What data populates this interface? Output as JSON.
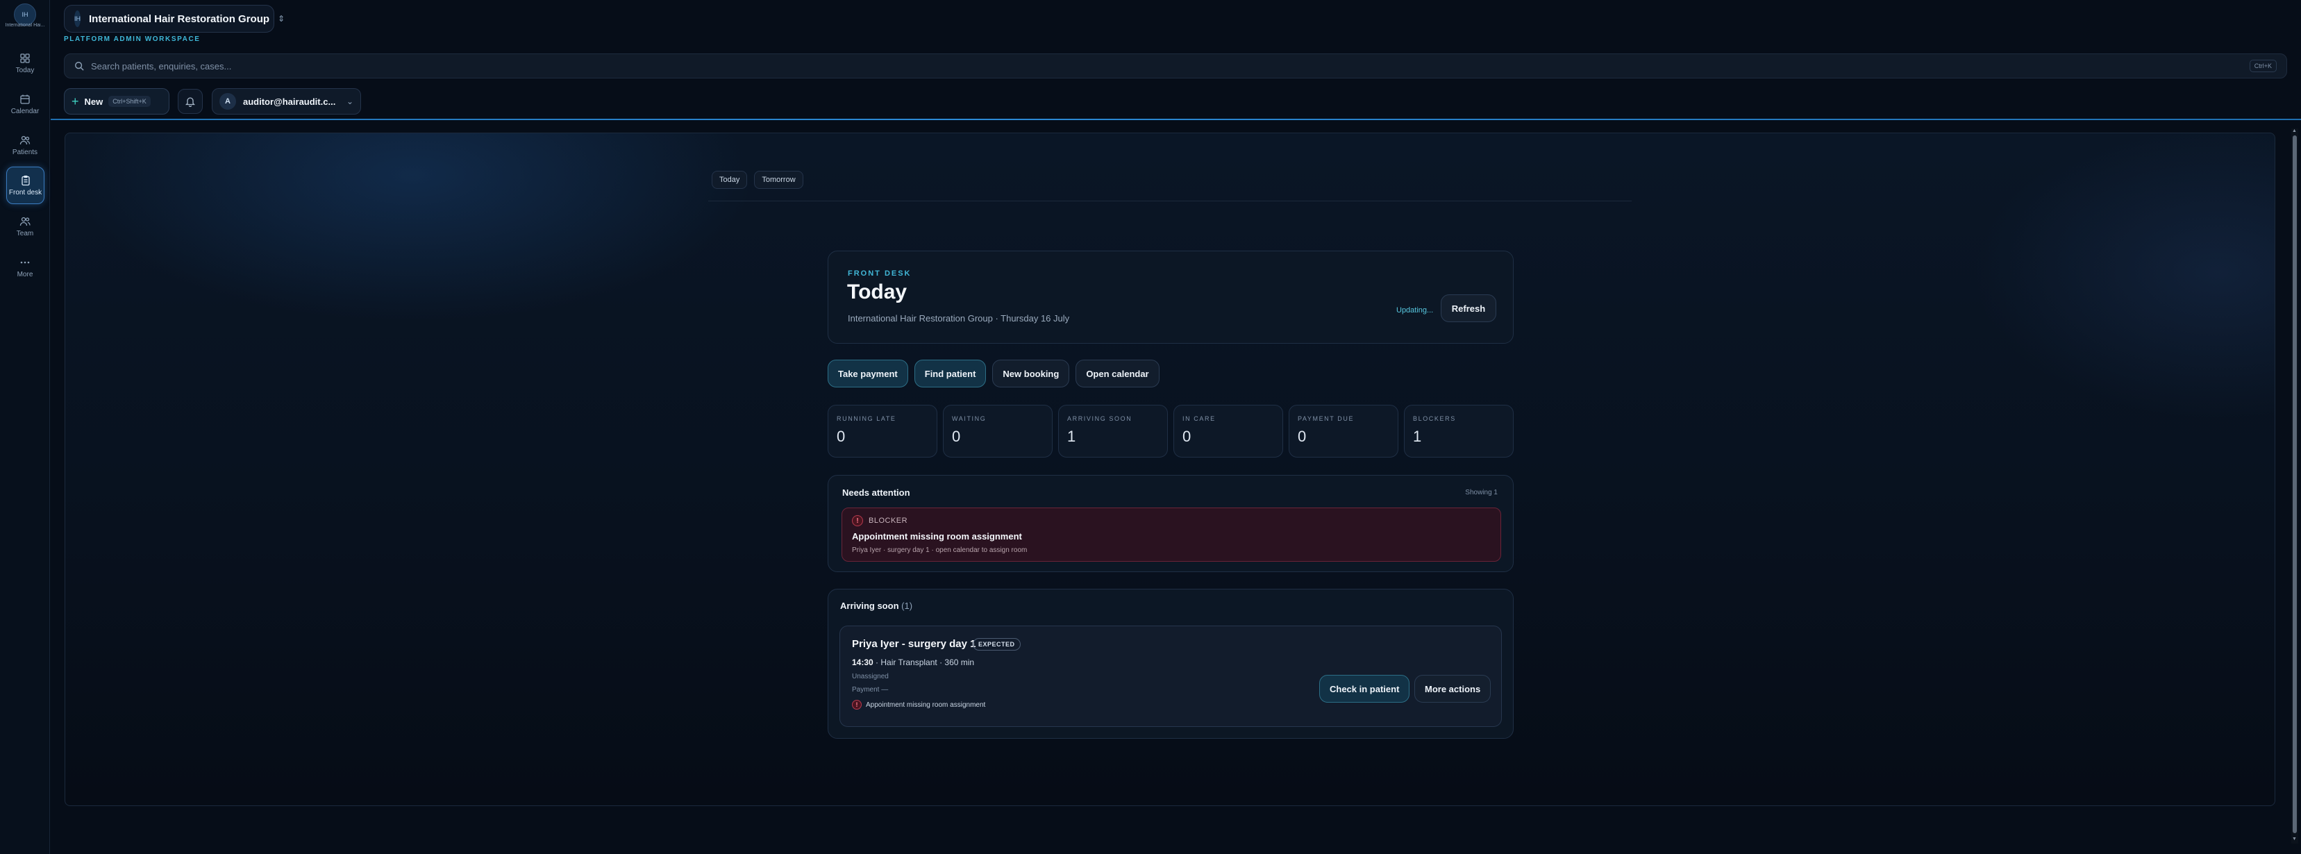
{
  "workspace": {
    "initials": "IH",
    "rail_name": "International Hai...",
    "name": "International Hair Restoration Group",
    "tag": "PLATFORM ADMIN WORKSPACE"
  },
  "nav": {
    "items": [
      {
        "label": "Today",
        "icon": "grid-icon"
      },
      {
        "label": "Calendar",
        "icon": "calendar-icon"
      },
      {
        "label": "Patients",
        "icon": "users-icon"
      },
      {
        "label": "Front desk",
        "icon": "clipboard-icon",
        "active": true
      },
      {
        "label": "Team",
        "icon": "team-icon"
      },
      {
        "label": "More",
        "icon": "more-icon"
      }
    ]
  },
  "search": {
    "placeholder": "Search patients, enquiries, cases...",
    "shortcut": "Ctrl+K"
  },
  "toolbar": {
    "new_label": "New",
    "new_shortcut": "Ctrl+Shift+K",
    "user_initial": "A",
    "user_email": "auditor@hairaudit.c..."
  },
  "day_tabs": [
    "Today",
    "Tomorrow"
  ],
  "hero": {
    "eyebrow": "FRONT DESK",
    "title": "Today",
    "subtitle": "International Hair Restoration Group · Thursday 16 July",
    "updating": "Updating...",
    "refresh_label": "Refresh"
  },
  "actions": {
    "take_payment": "Take payment",
    "find_patient": "Find patient",
    "new_booking": "New booking",
    "open_calendar": "Open calendar"
  },
  "stats": [
    {
      "label": "RUNNING LATE",
      "value": "0"
    },
    {
      "label": "WAITING",
      "value": "0"
    },
    {
      "label": "ARRIVING SOON",
      "value": "1"
    },
    {
      "label": "IN CARE",
      "value": "0"
    },
    {
      "label": "PAYMENT DUE",
      "value": "0"
    },
    {
      "label": "BLOCKERS",
      "value": "1"
    }
  ],
  "attention": {
    "title": "Needs attention",
    "showing": "Showing 1",
    "blocker_label": "BLOCKER",
    "blocker_title": "Appointment missing room assignment",
    "blocker_detail": "Priya Iyer · surgery day 1 · open calendar to assign room"
  },
  "arriving": {
    "title": "Arriving soon",
    "count": "(1)",
    "appointment": {
      "name": "Priya Iyer - surgery day 1",
      "status": "EXPECTED",
      "time": "14:30",
      "detail": " · Hair Transplant · 360 min",
      "room": "Unassigned",
      "payment": "Payment —",
      "issue": "Appointment missing room assignment",
      "check_in_label": "Check in patient",
      "more_label": "More actions"
    }
  },
  "colors": {
    "accent": "#3fb8d8",
    "background": "#060d18",
    "blocker": "#6a2438"
  }
}
